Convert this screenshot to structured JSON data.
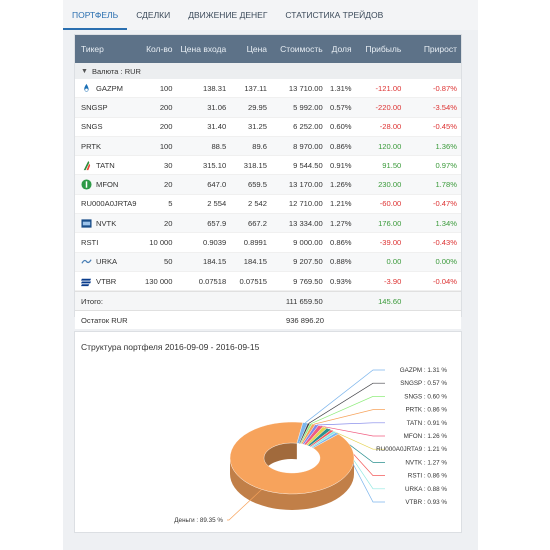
{
  "tabs": [
    "ПОРТФЕЛЬ",
    "СДЕЛКИ",
    "ДВИЖЕНИЕ ДЕНЕГ",
    "СТАТИСТИКА ТРЕЙДОВ"
  ],
  "table": {
    "headers": [
      "Тикер",
      "Кол-во",
      "Цена входа",
      "Цена",
      "Стоимость",
      "Доля",
      "Прибыль",
      "Прирост"
    ],
    "group_label": "Валюта : RUR",
    "rows": [
      {
        "ticker": "GAZPM",
        "icon": "gazprom-logo",
        "qty": "100",
        "entry": "138.31",
        "price": "137.11",
        "value": "13 710.00",
        "share": "1.31%",
        "profit": "-121.00",
        "growth": "-0.87%"
      },
      {
        "ticker": "SNGSP",
        "icon": "",
        "qty": "200",
        "entry": "31.06",
        "price": "29.95",
        "value": "5 992.00",
        "share": "0.57%",
        "profit": "-220.00",
        "growth": "-3.54%"
      },
      {
        "ticker": "SNGS",
        "icon": "",
        "qty": "200",
        "entry": "31.40",
        "price": "31.25",
        "value": "6 252.00",
        "share": "0.60%",
        "profit": "-28.00",
        "growth": "-0.45%"
      },
      {
        "ticker": "PRTK",
        "icon": "",
        "qty": "100",
        "entry": "88.5",
        "price": "89.6",
        "value": "8 970.00",
        "share": "0.86%",
        "profit": "120.00",
        "growth": "1.36%"
      },
      {
        "ticker": "TATN",
        "icon": "tatneft-logo",
        "qty": "30",
        "entry": "315.10",
        "price": "318.15",
        "value": "9 544.50",
        "share": "0.91%",
        "profit": "91.50",
        "growth": "0.97%"
      },
      {
        "ticker": "MFON",
        "icon": "megafon-logo",
        "qty": "20",
        "entry": "647.0",
        "price": "659.5",
        "value": "13 170.00",
        "share": "1.26%",
        "profit": "230.00",
        "growth": "1.78%"
      },
      {
        "ticker": "RU000A0JRTA9",
        "icon": "",
        "qty": "5",
        "entry": "2 554",
        "price": "2 542",
        "value": "12 710.00",
        "share": "1.21%",
        "profit": "-60.00",
        "growth": "-0.47%"
      },
      {
        "ticker": "NVTK",
        "icon": "novatek-logo",
        "qty": "20",
        "entry": "657.9",
        "price": "667.2",
        "value": "13 334.00",
        "share": "1.27%",
        "profit": "176.00",
        "growth": "1.34%"
      },
      {
        "ticker": "RSTI",
        "icon": "",
        "qty": "10 000",
        "entry": "0.9039",
        "price": "0.8991",
        "value": "9 000.00",
        "share": "0.86%",
        "profit": "-39.00",
        "growth": "-0.43%"
      },
      {
        "ticker": "URKA",
        "icon": "uralkali-logo",
        "qty": "50",
        "entry": "184.15",
        "price": "184.15",
        "value": "9 207.50",
        "share": "0.88%",
        "profit": "0.00",
        "growth": "0.00%"
      },
      {
        "ticker": "VTBR",
        "icon": "vtb-logo",
        "qty": "130 000",
        "entry": "0.07518",
        "price": "0.07515",
        "value": "9 769.50",
        "share": "0.93%",
        "profit": "-3.90",
        "growth": "-0.04%"
      }
    ],
    "total": {
      "label": "Итого:",
      "value": "111 659.50",
      "profit": "145.60"
    },
    "cash": {
      "label": "Остаток RUR",
      "value": "936 896.20"
    }
  },
  "chart_data": {
    "type": "pie",
    "title": "Структура портфеля 2016-09-09 - 2016-09-15",
    "slices": [
      {
        "label": "GAZPM : 1.31 %",
        "value": 1.31,
        "color": "#7cb5ec"
      },
      {
        "label": "SNGSP : 0.57 %",
        "value": 0.57,
        "color": "#434348"
      },
      {
        "label": "SNGS : 0.60 %",
        "value": 0.6,
        "color": "#90ed7d"
      },
      {
        "label": "PRTK : 0.86 %",
        "value": 0.86,
        "color": "#f7a35c"
      },
      {
        "label": "TATN : 0.91 %",
        "value": 0.91,
        "color": "#8085e9"
      },
      {
        "label": "MFON : 1.26 %",
        "value": 1.26,
        "color": "#f15c80"
      },
      {
        "label": "RU000A0JRTA9 : 1.21 %",
        "value": 1.21,
        "color": "#e4d354"
      },
      {
        "label": "NVTK : 1.27 %",
        "value": 1.27,
        "color": "#2b908f"
      },
      {
        "label": "RSTI : 0.86 %",
        "value": 0.86,
        "color": "#f45b5b"
      },
      {
        "label": "URKA : 0.88 %",
        "value": 0.88,
        "color": "#91e8e1"
      },
      {
        "label": "VTBR : 0.93 %",
        "value": 0.93,
        "color": "#7cb5ec"
      },
      {
        "label": "Деньги : 89.35 %",
        "value": 89.35,
        "color": "#f7a35c"
      }
    ]
  }
}
